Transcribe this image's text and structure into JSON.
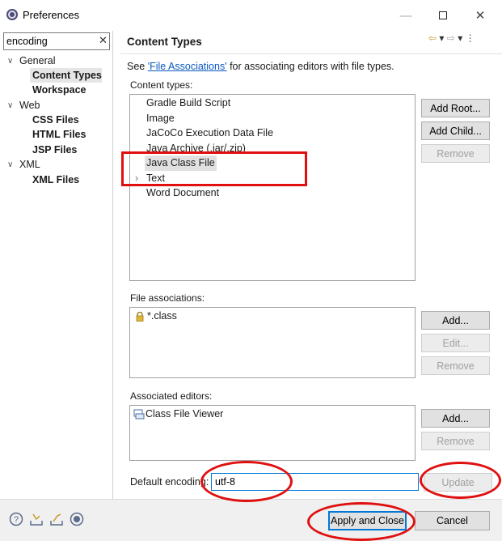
{
  "window": {
    "title": "Preferences",
    "min": "—",
    "max": "",
    "close": "✕"
  },
  "filter": {
    "value": "encoding",
    "clear": "✕"
  },
  "tree": {
    "general": {
      "label": "General",
      "twisty": "∨"
    },
    "content_types": "Content Types",
    "workspace": "Workspace",
    "web": {
      "label": "Web",
      "twisty": "∨"
    },
    "css_files": "CSS Files",
    "html_files": "HTML Files",
    "jsp_files": "JSP Files",
    "xml": {
      "label": "XML",
      "twisty": "∨"
    },
    "xml_files": "XML Files"
  },
  "page": {
    "title": "Content Types",
    "see_prefix": "See ",
    "see_link": "'File Associations'",
    "see_suffix": " for associating editors with file types."
  },
  "content_types": {
    "label": "Content types:",
    "items": [
      "Gradle Build Script",
      "Image",
      "JaCoCo Execution Data File",
      "Java Archive (.jar/.zip)",
      "Java Class File",
      "Text",
      "Word Document"
    ],
    "text_twisty": "›",
    "buttons": {
      "add_root": "Add Root...",
      "add_child": "Add Child...",
      "remove": "Remove"
    }
  },
  "file_associations": {
    "label": "File associations:",
    "items": [
      "*.class"
    ],
    "buttons": {
      "add": "Add...",
      "edit": "Edit...",
      "remove": "Remove"
    }
  },
  "associated_editors": {
    "label": "Associated editors:",
    "items": [
      "Class File Viewer"
    ],
    "buttons": {
      "add": "Add...",
      "remove": "Remove"
    }
  },
  "encoding": {
    "label": "Default encoding:",
    "value": "utf-8",
    "update": "Update"
  },
  "footer": {
    "apply_close": "Apply and Close",
    "cancel": "Cancel"
  },
  "icons": [
    "help-icon",
    "import-icon",
    "export-icon",
    "record-icon",
    "lock-icon",
    "class-file-viewer-icon"
  ],
  "colors": {
    "annotation": "#e01010",
    "link": "#0a59c1",
    "focus": "#0078d7"
  }
}
